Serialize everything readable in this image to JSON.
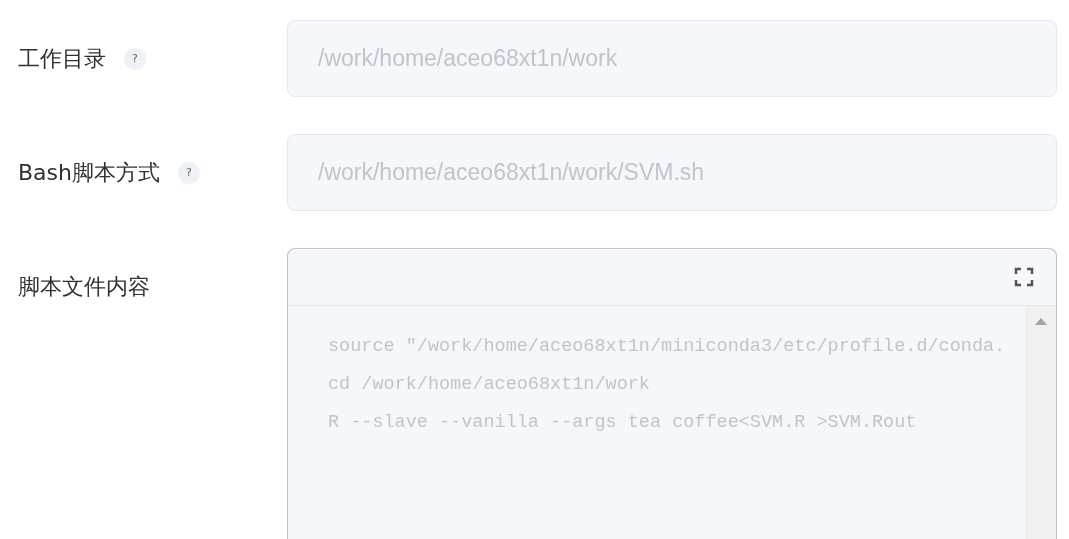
{
  "fields": [
    {
      "kind": "input",
      "label": "工作目录",
      "help": "?",
      "value": "/work/home/aceo68xt1n/work",
      "disabled": true
    },
    {
      "kind": "input",
      "label": "Bash脚本方式",
      "help": "?",
      "value": "/work/home/aceo68xt1n/work/SVM.sh",
      "disabled": true
    },
    {
      "kind": "editor",
      "label": "脚本文件内容",
      "lines": [
        "source ″/work/home/aceo68xt1n/miniconda3/etc/profile.d/conda.",
        "cd /work/home/aceo68xt1n/work",
        "R --slave --vanilla --args tea coffee<SVM.R >SVM.Rout"
      ],
      "disabled": true
    }
  ]
}
